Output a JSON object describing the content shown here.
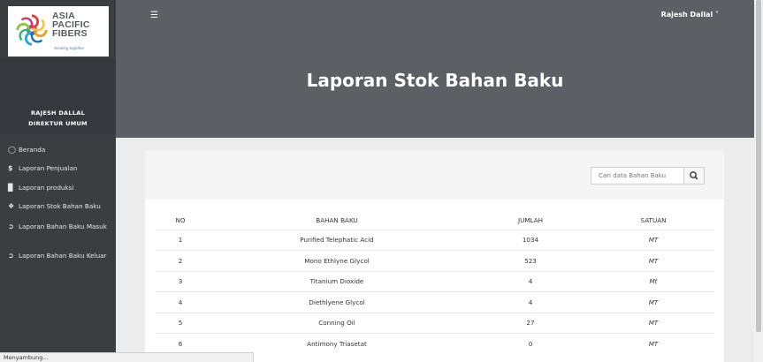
{
  "logo": {
    "lines": [
      "ASIA",
      "PACIFIC",
      "FIBERS"
    ],
    "tagline": "Working together"
  },
  "user": {
    "name": "RAJESH DALLAL",
    "role": "DIREKTUR UMUM",
    "menu_label": "Rajesh Dallal"
  },
  "sidebar": {
    "items": [
      {
        "label": "Beranda",
        "icon": "dashboard-icon"
      },
      {
        "label": "Laporan Penjualan",
        "icon": "dollar-icon"
      },
      {
        "label": "Laporan produksi",
        "icon": "bar-chart-icon"
      },
      {
        "label": "Laporan Stok Bahan Baku",
        "icon": "cubes-icon"
      },
      {
        "label": "Laporan Bahan Baku Masuk",
        "icon": "sign-in-icon"
      },
      {
        "label": "Laporan Bahan Baku Keluar",
        "icon": "sign-in-icon"
      }
    ]
  },
  "header": {
    "title": "Laporan Stok Bahan Baku"
  },
  "search": {
    "placeholder": "Cari data Bahan Baku"
  },
  "table": {
    "headers": [
      "NO",
      "BAHAN BAKU",
      "JUMLAH",
      "SATUAN"
    ],
    "rows": [
      [
        "1",
        "Purified Telephatic Acid",
        "1034",
        "MT"
      ],
      [
        "2",
        "Mono Ethlyne Glycol",
        "523",
        "MT"
      ],
      [
        "3",
        "Titanium Dioxide",
        "4",
        "Mt"
      ],
      [
        "4",
        "Diethlyene Glycol",
        "4",
        "MT"
      ],
      [
        "5",
        "Conning Oil",
        "27",
        "MT"
      ],
      [
        "6",
        "Antimony Triasetat",
        "0",
        "MT"
      ]
    ]
  },
  "status": "Menyambung..."
}
